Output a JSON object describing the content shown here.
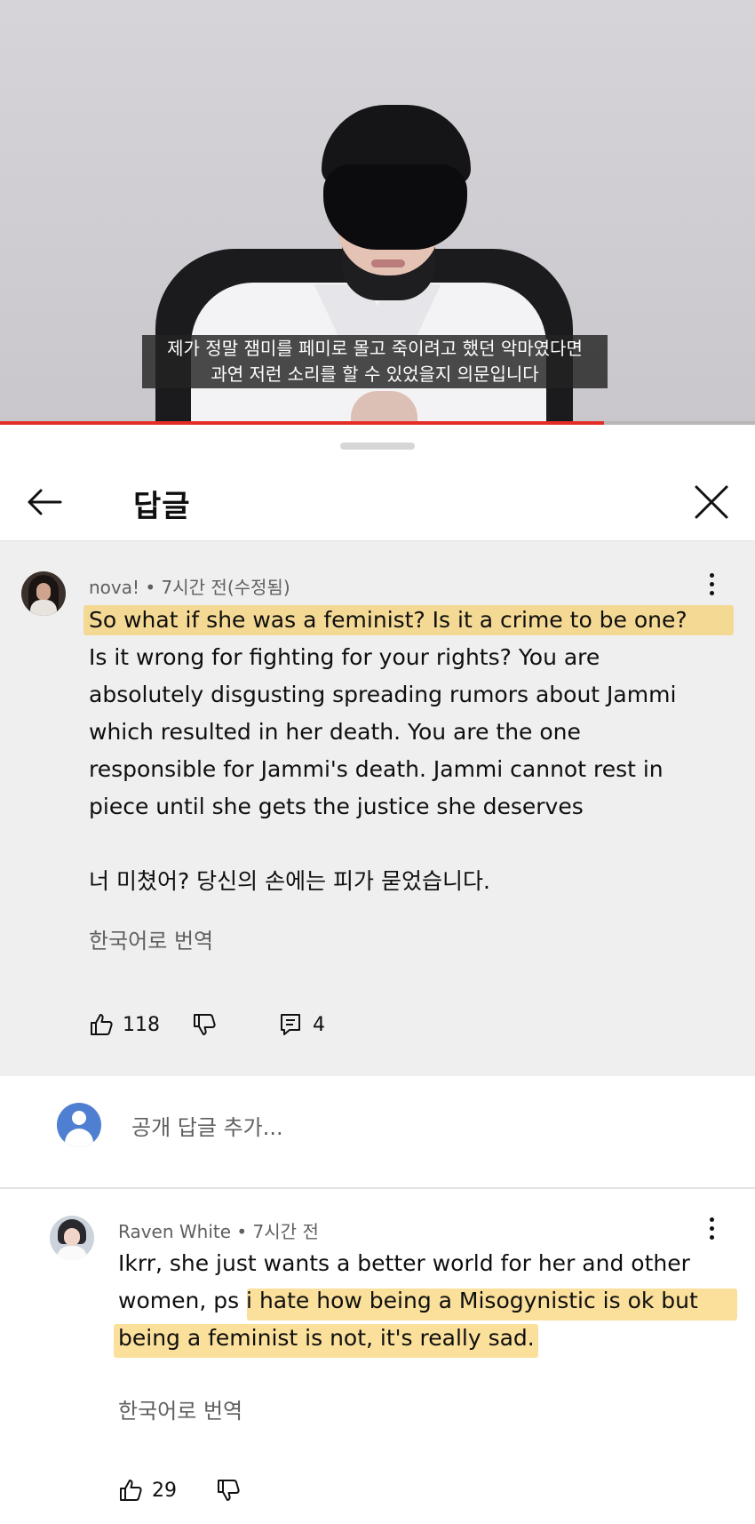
{
  "video": {
    "subtitle_line1": "제가 정말 잼미를 페미로 몰고 죽이려고 했던 악마였다면",
    "subtitle_line2": "과연 저런 소리를 할 수 있었을지 의문입니다",
    "progress_fraction": 0.8
  },
  "header": {
    "title": "답글",
    "back_icon": "back-arrow-icon",
    "close_icon": "close-icon"
  },
  "parent_comment": {
    "author": "nova!",
    "meta": "• 7시간 전(수정됨)",
    "text": "So what if she was a feminist? Is it a crime to be one?\nIs it wrong for fighting for your rights? You are\nabsolutely disgusting spreading rumors about Jammi\nwhich resulted in her death. You are the one\nresponsible for Jammi's death. Jammi cannot rest in\npiece until she gets the justice she deserves\n\n너 미쳤어? 당신의 손에는 피가 묻었습니다.",
    "translate": "한국어로 번역",
    "likes": "118",
    "replies": "4"
  },
  "composer": {
    "placeholder": "공개 답글 추가..."
  },
  "reply": {
    "author": "Raven White",
    "meta": "• 7시간 전",
    "text": "Ikrr, she just wants a better world for her and other\nwomen, ps i hate how being a Misogynistic is ok but\nbeing a feminist is not, it's really sad.",
    "translate": "한국어로 번역",
    "likes": "29"
  },
  "colors": {
    "highlight": "#f7c749",
    "progress": "#e52d27",
    "parent_bg": "#efefef"
  }
}
